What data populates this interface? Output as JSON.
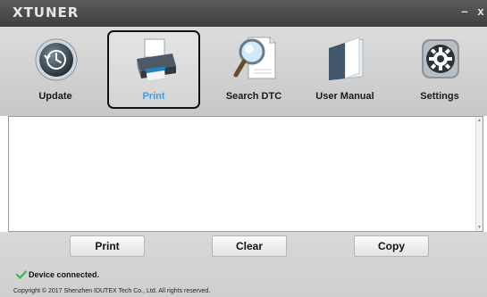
{
  "window": {
    "title": "XTUNER",
    "minimize_label": "–",
    "close_label": "x"
  },
  "toolbar": {
    "items": [
      {
        "label": "Update",
        "icon": "clock-icon",
        "active": false
      },
      {
        "label": "Print",
        "icon": "printer-icon",
        "active": true
      },
      {
        "label": "Search DTC",
        "icon": "magnifier-icon",
        "active": false
      },
      {
        "label": "User Manual",
        "icon": "book-icon",
        "active": false
      },
      {
        "label": "Settings",
        "icon": "gear-icon",
        "active": false
      }
    ]
  },
  "output": {
    "text": ""
  },
  "actions": {
    "print_label": "Print",
    "clear_label": "Clear",
    "copy_label": "Copy"
  },
  "status": {
    "text": "Device connected.",
    "icon": "checkmark-icon",
    "color": "#4caf50"
  },
  "footer": {
    "copyright": "Copyright © 2017 Shenzhen IDUTEX Tech Co., Ltd. All rights reserved."
  },
  "colors": {
    "active_label": "#3e9ee0",
    "titlebar": "#4a4a4a"
  }
}
